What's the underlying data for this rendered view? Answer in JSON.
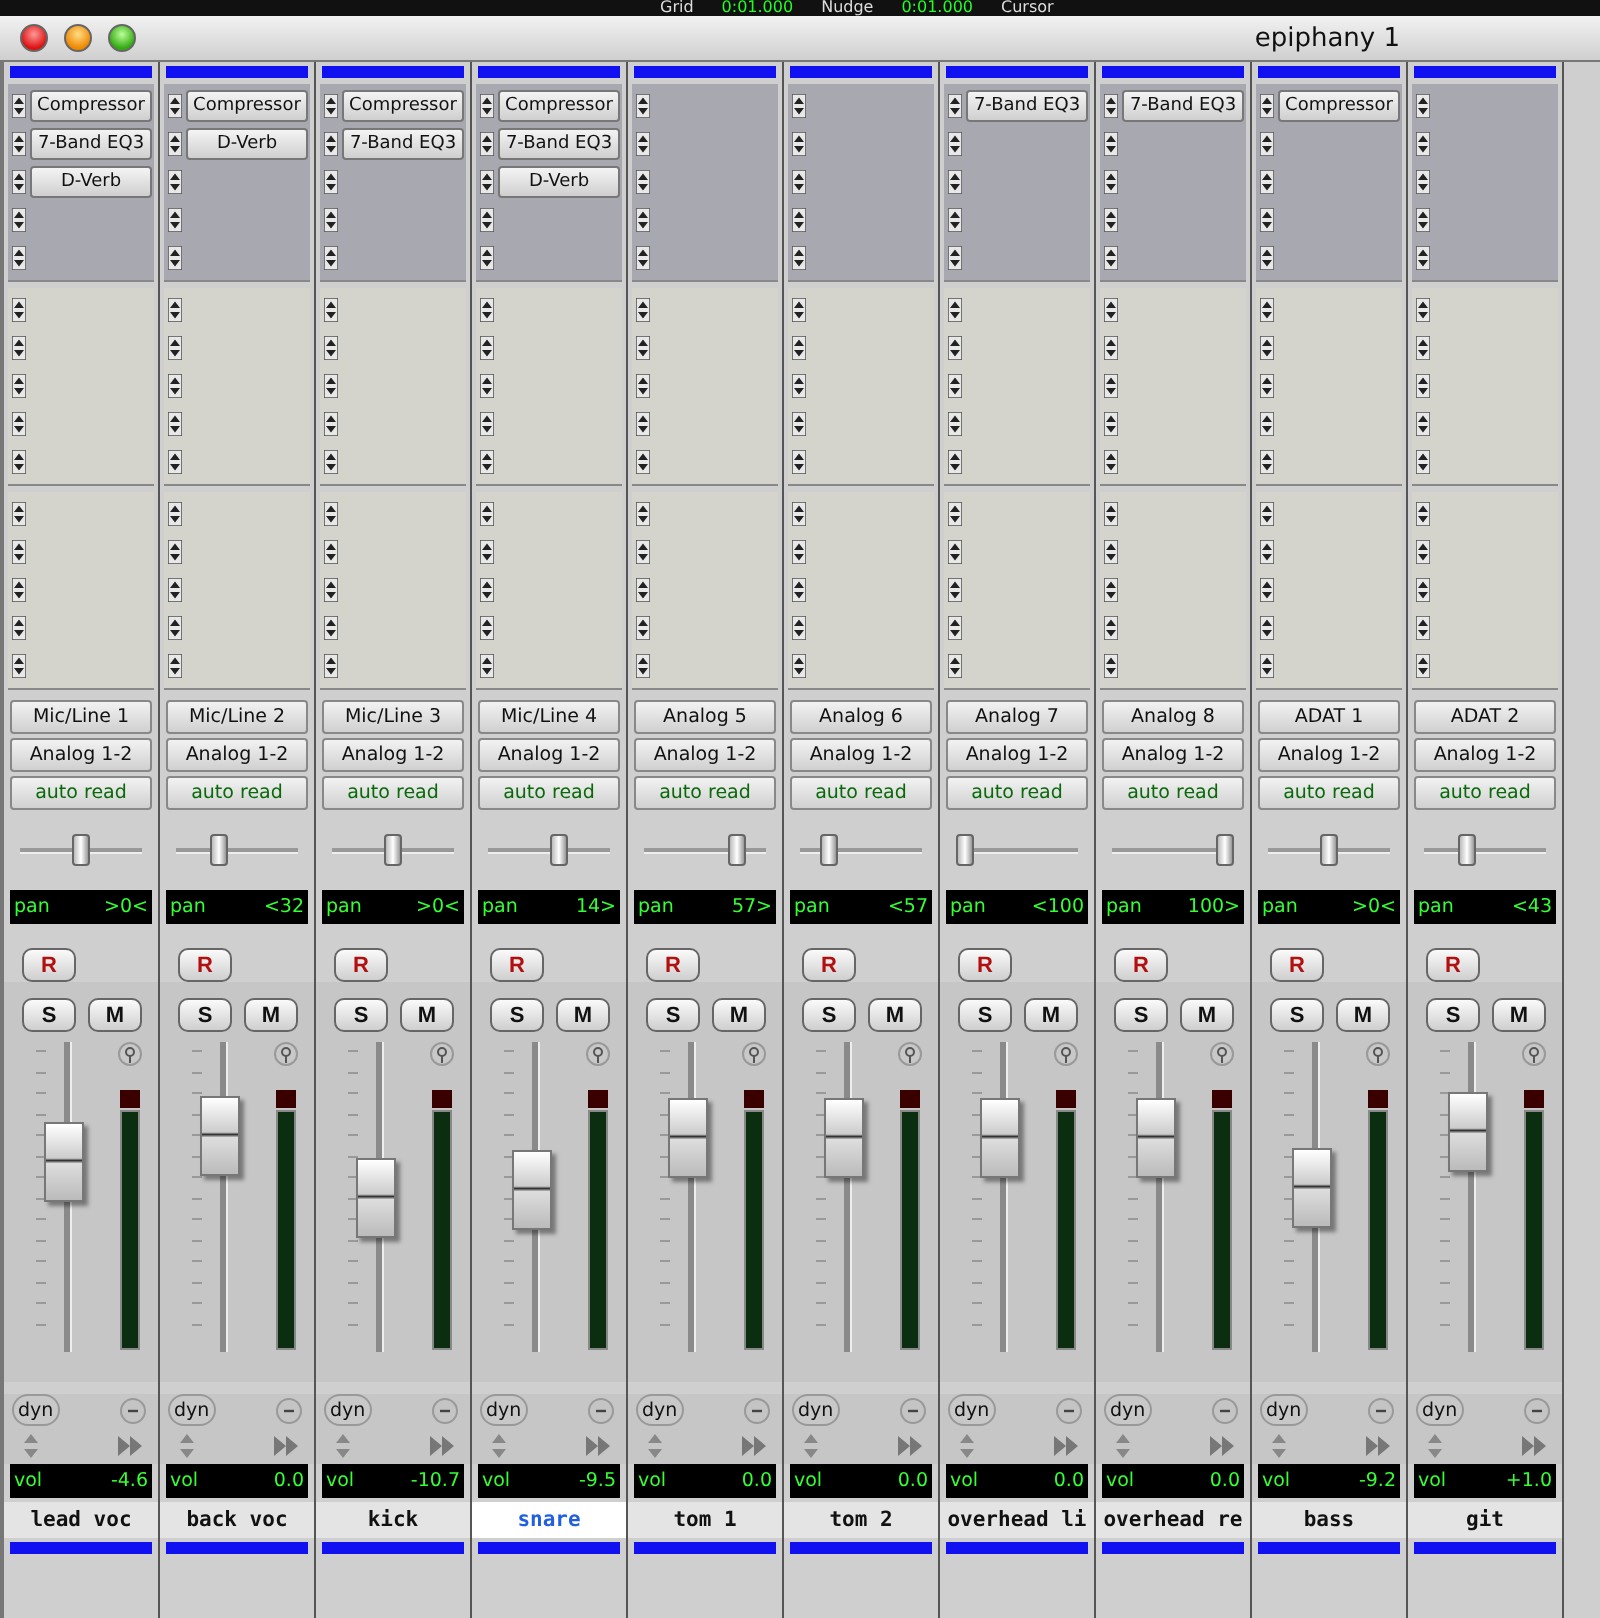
{
  "toolbar": {
    "items": [
      {
        "kind": "label",
        "text": "Grid"
      },
      {
        "kind": "readout",
        "text": "0:01.000"
      },
      {
        "kind": "label",
        "text": "Nudge"
      },
      {
        "kind": "readout",
        "text": "0:01.000"
      },
      {
        "kind": "label",
        "text": "Cursor"
      }
    ]
  },
  "window": {
    "title": "epiphany 1"
  },
  "channels": [
    {
      "inserts": [
        "Compressor",
        "7-Band EQ3",
        "D-Verb"
      ],
      "input": "Mic/Line 1",
      "output": "Analog 1-2",
      "automation": "auto read",
      "pan": {
        "level": 0.5,
        "label": "pan",
        "reading": ">0<"
      },
      "record": "R",
      "solo": "S",
      "mute": "M",
      "dyn": "dyn",
      "fader": {
        "level": 0.66
      },
      "volume": {
        "label": "vol",
        "reading": "-4.6"
      },
      "name": "lead voc",
      "selected": false
    },
    {
      "inserts": [
        "Compressor",
        "D-Verb"
      ],
      "input": "Mic/Line 2",
      "output": "Analog 1-2",
      "automation": "auto read",
      "pan": {
        "level": 0.32,
        "label": "pan",
        "reading": "<32"
      },
      "record": "R",
      "solo": "S",
      "mute": "M",
      "dyn": "dyn",
      "fader": {
        "level": 0.77
      },
      "volume": {
        "label": "vol",
        "reading": "0.0"
      },
      "name": "back voc",
      "selected": false
    },
    {
      "inserts": [
        "Compressor",
        "7-Band EQ3"
      ],
      "input": "Mic/Line 3",
      "output": "Analog 1-2",
      "automation": "auto read",
      "pan": {
        "level": 0.5,
        "label": "pan",
        "reading": ">0<"
      },
      "record": "R",
      "solo": "S",
      "mute": "M",
      "dyn": "dyn",
      "fader": {
        "level": 0.51
      },
      "volume": {
        "label": "vol",
        "reading": "-10.7"
      },
      "name": "kick",
      "selected": false
    },
    {
      "inserts": [
        "Compressor",
        "7-Band EQ3",
        "D-Verb"
      ],
      "input": "Mic/Line 4",
      "output": "Analog 1-2",
      "automation": "auto read",
      "pan": {
        "level": 0.6,
        "label": "pan",
        "reading": "14>"
      },
      "record": "R",
      "solo": "S",
      "mute": "M",
      "dyn": "dyn",
      "fader": {
        "level": 0.54
      },
      "volume": {
        "label": "vol",
        "reading": "-9.5"
      },
      "name": "snare",
      "selected": true
    },
    {
      "input": "Analog 5",
      "output": "Analog 1-2",
      "automation": "auto read",
      "pan": {
        "level": 0.8,
        "label": "pan",
        "reading": "57>"
      },
      "record": "R",
      "solo": "S",
      "mute": "M",
      "dyn": "dyn",
      "fader": {
        "level": 0.76
      },
      "volume": {
        "label": "vol",
        "reading": "0.0"
      },
      "name": "tom 1",
      "selected": false
    },
    {
      "input": "Analog 6",
      "output": "Analog 1-2",
      "automation": "auto read",
      "pan": {
        "level": 0.2,
        "label": "pan",
        "reading": "<57"
      },
      "record": "R",
      "solo": "S",
      "mute": "M",
      "dyn": "dyn",
      "fader": {
        "level": 0.76
      },
      "volume": {
        "label": "vol",
        "reading": "0.0"
      },
      "name": "tom 2",
      "selected": false
    },
    {
      "inserts": [
        "7-Band EQ3"
      ],
      "input": "Analog 7",
      "output": "Analog 1-2",
      "automation": "auto read",
      "pan": {
        "level": 0,
        "label": "pan",
        "reading": "<100"
      },
      "record": "R",
      "solo": "S",
      "mute": "M",
      "dyn": "dyn",
      "fader": {
        "level": 0.76
      },
      "volume": {
        "label": "vol",
        "reading": "0.0"
      },
      "name": "overhead li",
      "selected": false
    },
    {
      "inserts": [
        "7-Band EQ3"
      ],
      "input": "Analog 8",
      "output": "Analog 1-2",
      "automation": "auto read",
      "pan": {
        "level": 1,
        "label": "pan",
        "reading": "100>"
      },
      "record": "R",
      "solo": "S",
      "mute": "M",
      "dyn": "dyn",
      "fader": {
        "level": 0.76
      },
      "volume": {
        "label": "vol",
        "reading": "0.0"
      },
      "name": "overhead re",
      "selected": false
    },
    {
      "inserts": [
        "Compressor"
      ],
      "input": "ADAT 1",
      "output": "Analog 1-2",
      "automation": "auto read",
      "pan": {
        "level": 0.5,
        "label": "pan",
        "reading": ">0<"
      },
      "record": "R",
      "solo": "S",
      "mute": "M",
      "dyn": "dyn",
      "fader": {
        "level": 0.55
      },
      "volume": {
        "label": "vol",
        "reading": "-9.2"
      },
      "name": "bass",
      "selected": false
    },
    {
      "input": "ADAT 2",
      "output": "Analog 1-2",
      "automation": "auto read",
      "pan": {
        "level": 0.33,
        "label": "pan",
        "reading": "<43"
      },
      "record": "R",
      "solo": "S",
      "mute": "M",
      "dyn": "dyn",
      "fader": {
        "level": 0.79
      },
      "volume": {
        "label": "vol",
        "reading": "+1.0"
      },
      "name": "git",
      "selected": false
    }
  ]
}
